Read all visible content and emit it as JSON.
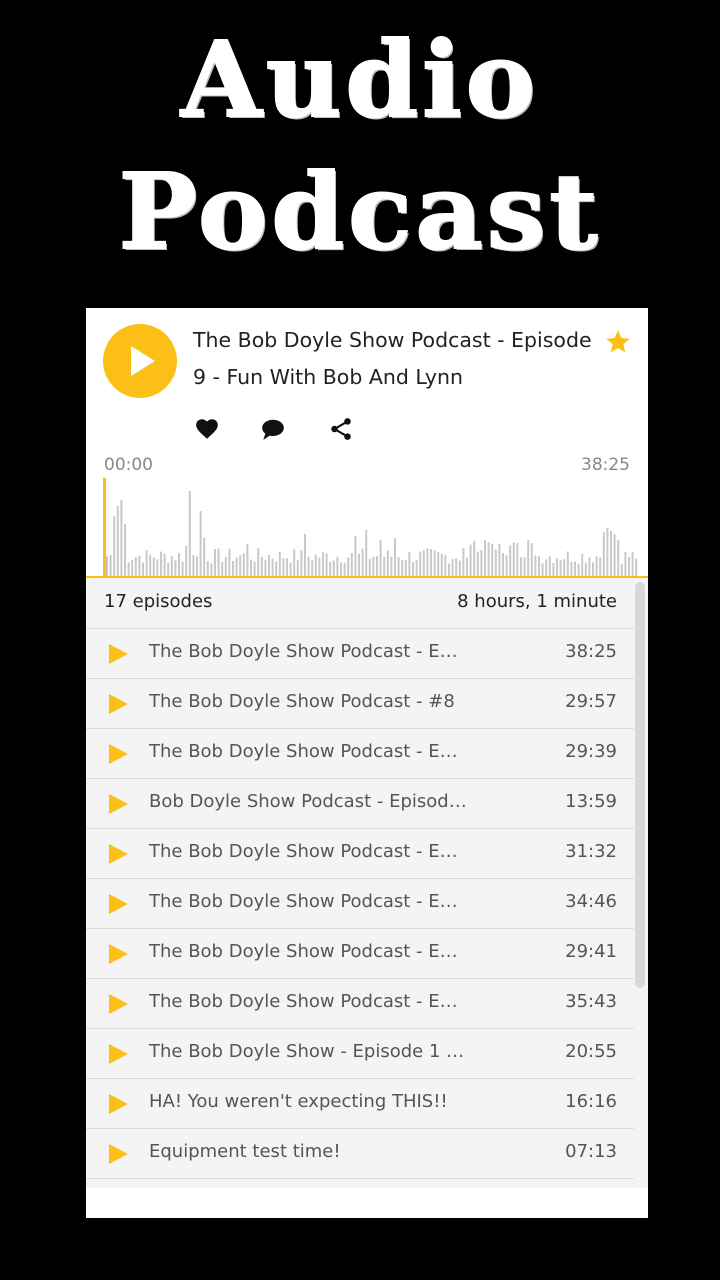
{
  "hero": {
    "line1": "Audio",
    "line2": "Podcast"
  },
  "player": {
    "title": "The Bob Doyle Show Podcast - Episode 9 - Fun With Bob And Lynn",
    "time_start": "00:00",
    "time_end": "38:25",
    "progress": 0.0,
    "accent_color": "#fbbf17",
    "icons": [
      "play-icon",
      "star-icon",
      "heart-icon",
      "comment-icon",
      "share-icon"
    ]
  },
  "list": {
    "count_label": "17 episodes",
    "total_label": "8 hours, 1 minute",
    "episodes": [
      {
        "title": "The Bob Doyle Show Podcast - Ep…",
        "duration": "38:25"
      },
      {
        "title": "The Bob Doyle Show Podcast - #8",
        "duration": "29:57"
      },
      {
        "title": "The Bob Doyle Show Podcast - Ep…",
        "duration": "29:39"
      },
      {
        "title": "Bob Doyle Show Podcast - Episod…",
        "duration": "13:59"
      },
      {
        "title": "The Bob Doyle Show Podcast - Ep…",
        "duration": "31:32"
      },
      {
        "title": "The Bob Doyle Show Podcast - Ep…",
        "duration": "34:46"
      },
      {
        "title": "The Bob Doyle Show Podcast - Ep…",
        "duration": "29:41"
      },
      {
        "title": "The Bob Doyle Show Podcast - Ep…",
        "duration": "35:43"
      },
      {
        "title": "The Bob Doyle Show - Episode 1 -…",
        "duration": "20:55"
      },
      {
        "title": "HA! You weren't expecting THIS!!",
        "duration": "16:16"
      },
      {
        "title": "Equipment test time!",
        "duration": "07:13"
      }
    ]
  }
}
